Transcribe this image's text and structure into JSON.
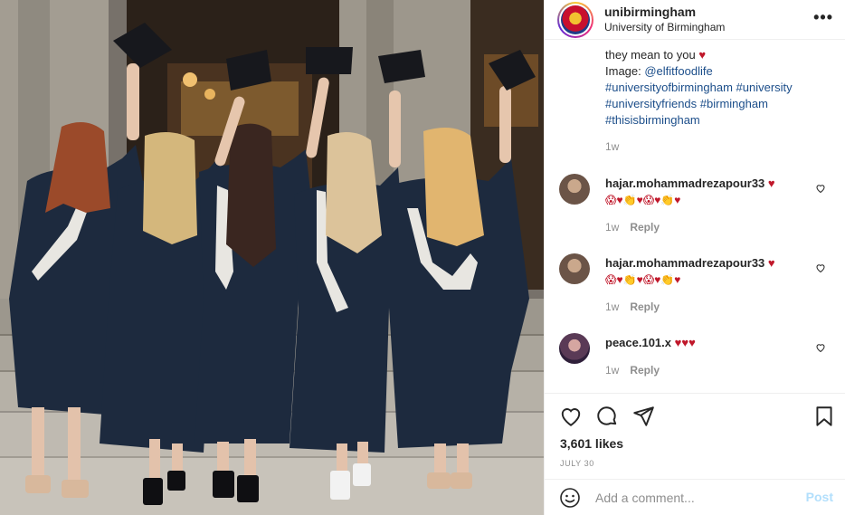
{
  "header": {
    "username": "unibirmingham",
    "subtitle": "University of Birmingham",
    "more_icon": "more-horizontal-icon"
  },
  "caption": {
    "line1": "they mean to you",
    "heart": "♥",
    "image_prefix": "Image: ",
    "image_credit": "@elfitfoodlife",
    "tags": [
      "#universityofbirmingham",
      "#university",
      "#universityfriends",
      "#birmingham",
      "#thisisbirmingham"
    ],
    "time": "1w"
  },
  "comments": [
    {
      "username": "hajar.mohammadrezapour33",
      "text": "♥",
      "emoji": "😱♥👏♥😱♥👏♥",
      "time": "1w",
      "reply": "Reply"
    },
    {
      "username": "hajar.mohammadrezapour33",
      "text": "♥",
      "emoji": "😱♥👏♥😱♥👏♥",
      "time": "1w",
      "reply": "Reply"
    },
    {
      "username": "peace.101.x",
      "text": "♥♥♥",
      "emoji": "",
      "time": "1w",
      "reply": "Reply"
    }
  ],
  "actions": {
    "likes": "3,601 likes",
    "date": "JULY 30"
  },
  "add_comment": {
    "placeholder": "Add a comment...",
    "post_label": "Post"
  },
  "colors": {
    "link": "#1c4e8a",
    "heart": "#c0172a",
    "muted": "#8e8e8e",
    "post_disabled": "#b2dffc"
  }
}
